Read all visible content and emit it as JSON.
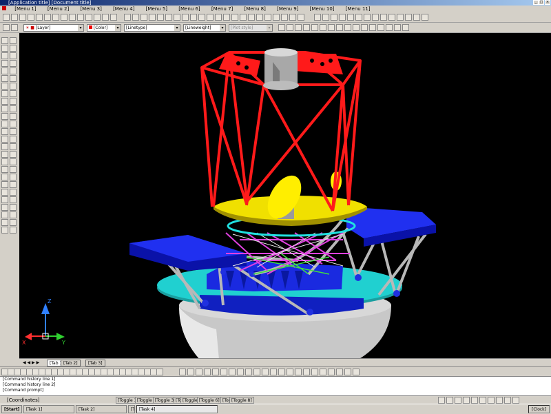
{
  "window": {
    "title": "[Application title]",
    "doc_title": "[Document title]",
    "controls": [
      "_",
      "□",
      "×"
    ]
  },
  "menu": {
    "items": [
      "[Menu 1]",
      "[Menu 2]",
      "[Menu 3]",
      "[Menu 4]",
      "[Menu 5]",
      "[Menu 6]",
      "[Menu 7]",
      "[Menu 8]",
      "[Menu 9]",
      "[Menu 10]",
      "[Menu 11]"
    ]
  },
  "properties": {
    "layer_value": "[Layer]",
    "color_value": "[Color]",
    "linetype_value": "[Linetype]",
    "lineweight_value": "[Lineweight]",
    "plotstyle_value": "[Plot style]"
  },
  "layout_tabs": [
    "[Tab 1]",
    "[Tab 2]",
    "[Tab 3]"
  ],
  "command_lines": [
    "[Command history line 1]",
    "[Command history line 2]",
    "[Command prompt]"
  ],
  "status": {
    "coordinates": "[Coordinates]",
    "toggles": [
      "[Toggle 1]",
      "[Toggle 2]",
      "[Toggle 3]",
      "[Toggle 4]",
      "[Toggle 5]",
      "[Toggle 6]",
      "[Toggle 7]",
      "[Toggle 8]"
    ]
  },
  "taskbar": {
    "start_label": "[Start]",
    "buttons": [
      "[Task 1]",
      "[Task 2]",
      "[Task 3]",
      "[Task 4]"
    ],
    "active_index": 3,
    "clock": "[Clock]"
  },
  "ucs": {
    "x_label": "X",
    "y_label": "Y",
    "z_label": "Z"
  },
  "colors": {
    "truss": "#ff1a1a",
    "dish": "#f0e000",
    "platform_blue": "#1020d0",
    "base_cyan": "#20d0d0",
    "magenta_frame": "#e040e0",
    "pier_gray": "#c8c8c8"
  }
}
